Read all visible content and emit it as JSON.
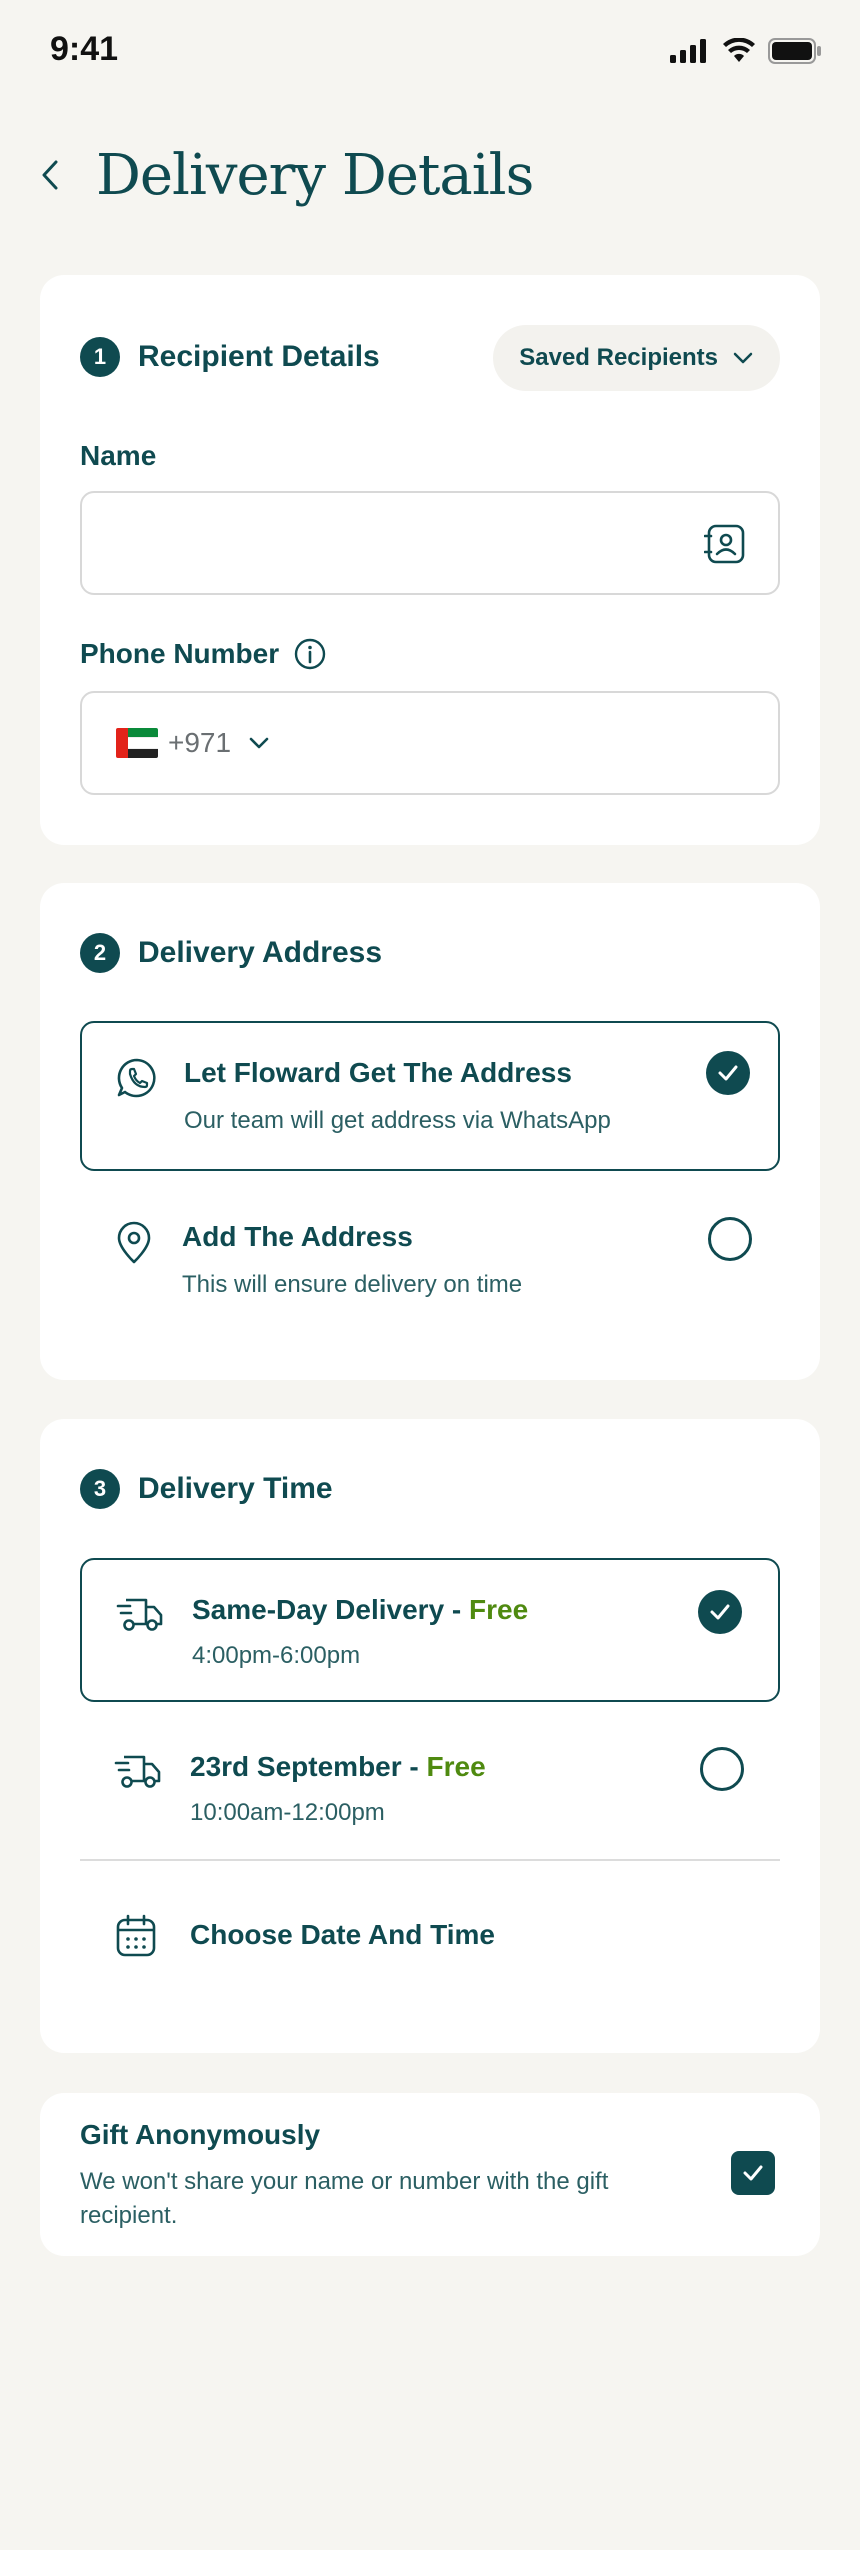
{
  "status_bar": {
    "time": "9:41"
  },
  "header": {
    "title": "Delivery Details"
  },
  "recipient": {
    "step": "1",
    "title": "Recipient Details",
    "saved_button": "Saved Recipients",
    "name_label": "Name",
    "name_value": "",
    "phone_label": "Phone Number",
    "country_code": "+971",
    "phone_value": ""
  },
  "address": {
    "step": "2",
    "title": "Delivery Address",
    "options": [
      {
        "title": "Let Floward Get The Address",
        "subtitle": "Our team will get address via WhatsApp",
        "selected": true,
        "icon": "whatsapp-icon"
      },
      {
        "title": "Add The Address",
        "subtitle": "This will ensure delivery on time",
        "selected": false,
        "icon": "location-pin-icon"
      }
    ]
  },
  "delivery_time": {
    "step": "3",
    "title": "Delivery Time",
    "options": [
      {
        "title": "Same-Day Delivery - ",
        "price": "Free",
        "time": "4:00pm-6:00pm",
        "selected": true,
        "icon": "truck-icon"
      },
      {
        "title": "23rd September - ",
        "price": "Free",
        "time": "10:00am-12:00pm",
        "selected": false,
        "icon": "truck-icon"
      }
    ],
    "choose_label": "Choose Date And Time"
  },
  "gift": {
    "title": "Gift Anonymously",
    "subtitle": "We won't share your name or number with the gift recipient.",
    "checked": true
  },
  "colors": {
    "primary": "#0f4a50",
    "accent_free": "#4f8a10",
    "background": "#f6f5f1",
    "card": "#ffffff"
  }
}
